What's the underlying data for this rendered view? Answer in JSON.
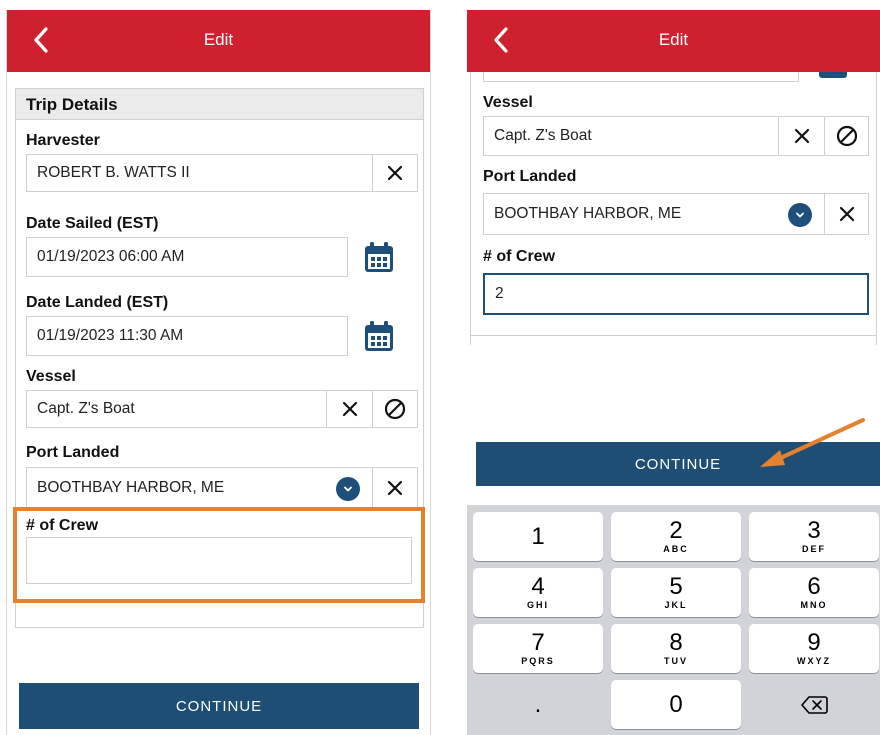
{
  "left": {
    "header": {
      "title": "Edit"
    },
    "section_title": "Trip Details",
    "harvester": {
      "label": "Harvester",
      "value": "ROBERT B. WATTS II"
    },
    "date_sailed": {
      "label": "Date Sailed (EST)",
      "value": "01/19/2023 06:00 AM"
    },
    "date_landed": {
      "label": "Date Landed (EST)",
      "value": "01/19/2023 11:30 AM"
    },
    "vessel": {
      "label": "Vessel",
      "value": "Capt. Z's Boat"
    },
    "port_landed": {
      "label": "Port Landed",
      "value": "BOOTHBAY HARBOR, ME"
    },
    "crew": {
      "label": "# of Crew",
      "value": ""
    },
    "continue_label": "CONTINUE"
  },
  "right": {
    "header": {
      "title": "Edit"
    },
    "vessel": {
      "label": "Vessel",
      "value": "Capt. Z's Boat"
    },
    "port_landed": {
      "label": "Port Landed",
      "value": "BOOTHBAY HARBOR, ME"
    },
    "crew": {
      "label": "# of Crew",
      "value": "2"
    },
    "continue_label": "CONTINUE",
    "keypad": {
      "keys": [
        {
          "num": "1",
          "letters": ""
        },
        {
          "num": "2",
          "letters": "ABC"
        },
        {
          "num": "3",
          "letters": "DEF"
        },
        {
          "num": "4",
          "letters": "GHI"
        },
        {
          "num": "5",
          "letters": "JKL"
        },
        {
          "num": "6",
          "letters": "MNO"
        },
        {
          "num": "7",
          "letters": "PQRS"
        },
        {
          "num": "8",
          "letters": "TUV"
        },
        {
          "num": "9",
          "letters": "WXYZ"
        },
        {
          "num": ".",
          "letters": ""
        },
        {
          "num": "0",
          "letters": ""
        }
      ]
    }
  },
  "colors": {
    "header": "#cf202f",
    "button": "#1f4e75",
    "highlight": "#e5822f",
    "calendar": "#1d4f7a"
  },
  "icons": [
    "chevron-left-icon",
    "clear-x-icon",
    "calendar-icon",
    "no-vessel-icon",
    "chevron-down-icon",
    "backspace-icon",
    "arrow-annotation-icon"
  ]
}
